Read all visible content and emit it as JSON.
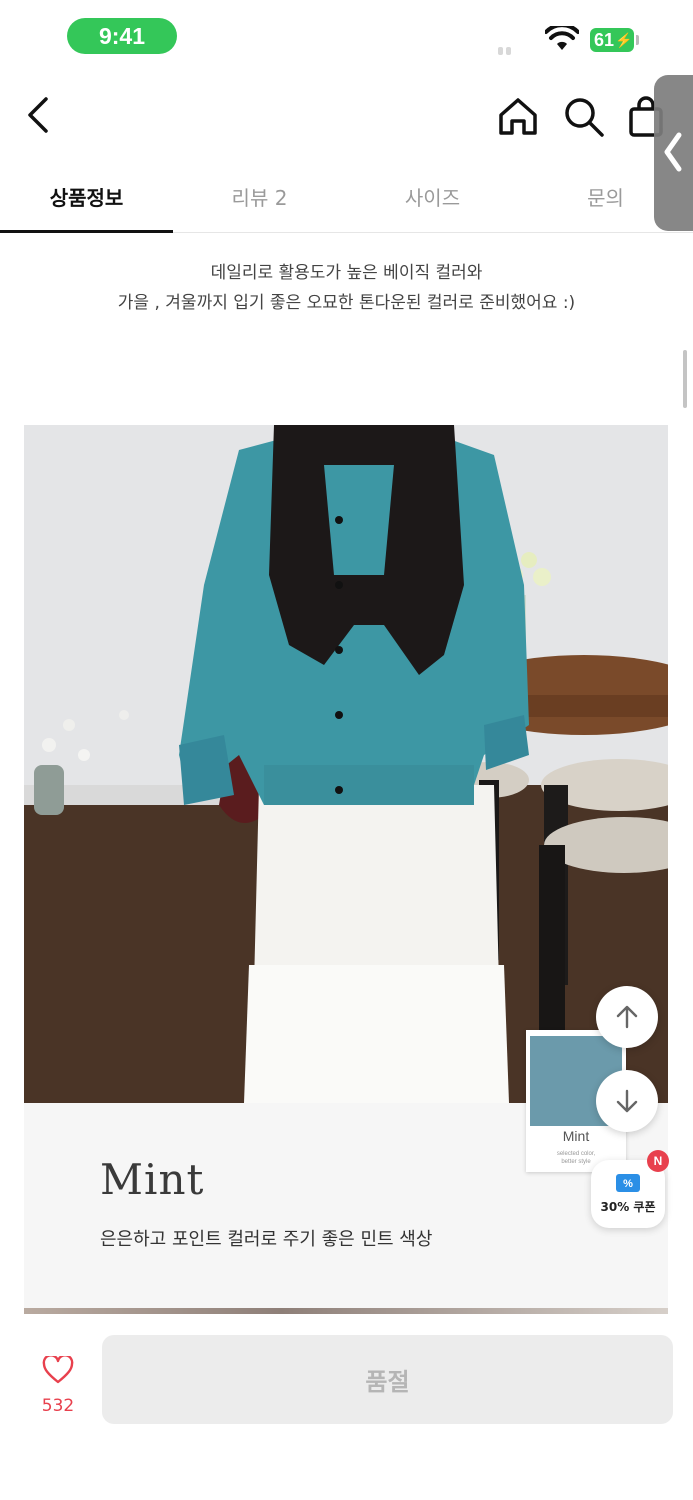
{
  "status_bar": {
    "time": "9:41",
    "battery": "61"
  },
  "tabs": [
    {
      "label": "상품정보",
      "active": true
    },
    {
      "label": "리뷰 2",
      "active": false
    },
    {
      "label": "사이즈",
      "active": false
    },
    {
      "label": "문의",
      "active": false
    }
  ],
  "description": {
    "line1": "데일리로 활용도가 높은 베이직 컬러와",
    "line2": "가을 , 겨울까지 입기 좋은 오묘한 톤다운된 컬러로 준비했어요 :)"
  },
  "color_card": {
    "name": "Mint",
    "desc": "은은하고 포인트 컬러로 주기 좋은 민트 색상",
    "swatch_label": "Mint",
    "swatch_small_line1": "selected color,",
    "swatch_small_line2": "better style",
    "swatch_color": "#6b9aab"
  },
  "coupon": {
    "label": "30% 쿠폰",
    "badge": "N"
  },
  "bottom_bar": {
    "like_count": "532",
    "soldout_label": "품절"
  },
  "colors": {
    "accent_red": "#e8404d",
    "status_green": "#34c759"
  }
}
